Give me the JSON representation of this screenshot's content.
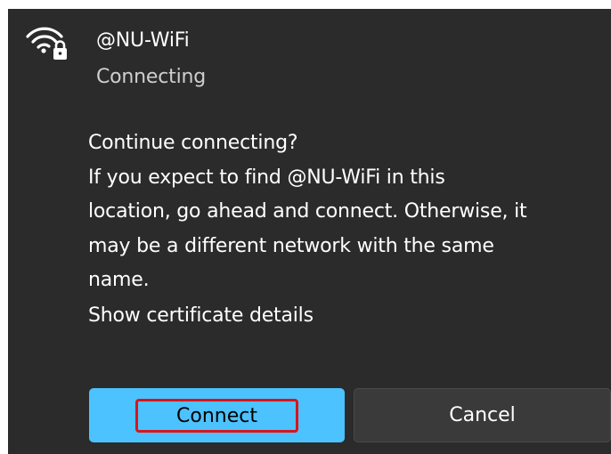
{
  "network": {
    "name": "@NU-WiFi",
    "status": "Connecting",
    "icon": "wifi-secured-icon"
  },
  "message": {
    "lines": [
      "Continue connecting?",
      "If you expect to find @NU-WiFi in this",
      "location, go ahead and connect. Otherwise, it",
      "may be a different network with the same",
      "name."
    ]
  },
  "links": {
    "certificate": "Show certificate details"
  },
  "buttons": {
    "connect": "Connect",
    "cancel": "Cancel"
  },
  "colors": {
    "panel_background": "#2b2b2b",
    "accent": "#4cc2ff",
    "highlight_outline": "#d9141c",
    "secondary_button": "#3a3a3a"
  }
}
